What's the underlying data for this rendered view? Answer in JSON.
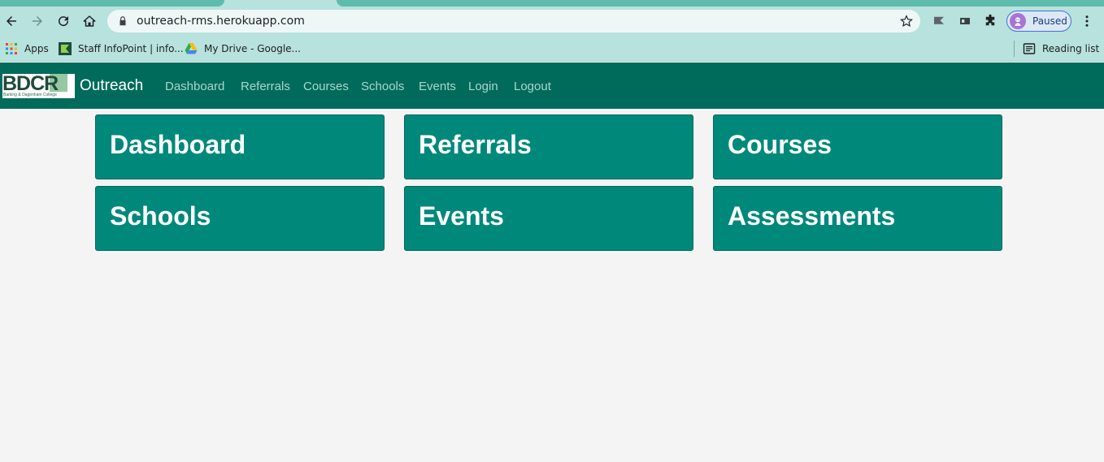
{
  "browser": {
    "url": "outreach-rms.herokuapp.com",
    "profile_label": "Paused",
    "bookmarks": [
      {
        "label": "Apps",
        "icon": "apps-grid-icon"
      },
      {
        "label": "Staff InfoPoint | info...",
        "icon": "staff-infopoint-icon"
      },
      {
        "label": "My Drive - Google...",
        "icon": "google-drive-icon"
      }
    ],
    "reading_list": "Reading list"
  },
  "navbar": {
    "brand": "Outreach",
    "logo_text": "BDCR",
    "logo_subtext": "Barking & Dagenham College",
    "links": [
      "Dashboard",
      "Referrals",
      "Courses",
      "Schools",
      "Events",
      "Login",
      "Logout"
    ]
  },
  "tiles": [
    "Dashboard",
    "Referrals",
    "Courses",
    "Schools",
    "Events",
    "Assessments"
  ],
  "colors": {
    "navbar": "#006b5b",
    "tile": "#00897b",
    "browser_chrome": "#b7e2dd"
  }
}
